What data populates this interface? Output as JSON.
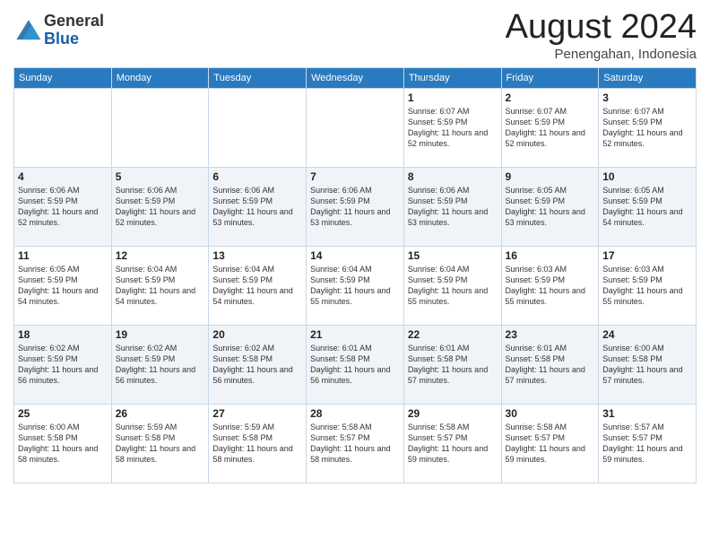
{
  "header": {
    "logo_general": "General",
    "logo_blue": "Blue",
    "month_title": "August 2024",
    "location": "Penengahan, Indonesia"
  },
  "weekdays": [
    "Sunday",
    "Monday",
    "Tuesday",
    "Wednesday",
    "Thursday",
    "Friday",
    "Saturday"
  ],
  "weeks": [
    [
      {
        "day": "",
        "sunrise": "",
        "sunset": "",
        "daylight": ""
      },
      {
        "day": "",
        "sunrise": "",
        "sunset": "",
        "daylight": ""
      },
      {
        "day": "",
        "sunrise": "",
        "sunset": "",
        "daylight": ""
      },
      {
        "day": "",
        "sunrise": "",
        "sunset": "",
        "daylight": ""
      },
      {
        "day": "1",
        "sunrise": "Sunrise: 6:07 AM",
        "sunset": "Sunset: 5:59 PM",
        "daylight": "Daylight: 11 hours and 52 minutes."
      },
      {
        "day": "2",
        "sunrise": "Sunrise: 6:07 AM",
        "sunset": "Sunset: 5:59 PM",
        "daylight": "Daylight: 11 hours and 52 minutes."
      },
      {
        "day": "3",
        "sunrise": "Sunrise: 6:07 AM",
        "sunset": "Sunset: 5:59 PM",
        "daylight": "Daylight: 11 hours and 52 minutes."
      }
    ],
    [
      {
        "day": "4",
        "sunrise": "Sunrise: 6:06 AM",
        "sunset": "Sunset: 5:59 PM",
        "daylight": "Daylight: 11 hours and 52 minutes."
      },
      {
        "day": "5",
        "sunrise": "Sunrise: 6:06 AM",
        "sunset": "Sunset: 5:59 PM",
        "daylight": "Daylight: 11 hours and 52 minutes."
      },
      {
        "day": "6",
        "sunrise": "Sunrise: 6:06 AM",
        "sunset": "Sunset: 5:59 PM",
        "daylight": "Daylight: 11 hours and 53 minutes."
      },
      {
        "day": "7",
        "sunrise": "Sunrise: 6:06 AM",
        "sunset": "Sunset: 5:59 PM",
        "daylight": "Daylight: 11 hours and 53 minutes."
      },
      {
        "day": "8",
        "sunrise": "Sunrise: 6:06 AM",
        "sunset": "Sunset: 5:59 PM",
        "daylight": "Daylight: 11 hours and 53 minutes."
      },
      {
        "day": "9",
        "sunrise": "Sunrise: 6:05 AM",
        "sunset": "Sunset: 5:59 PM",
        "daylight": "Daylight: 11 hours and 53 minutes."
      },
      {
        "day": "10",
        "sunrise": "Sunrise: 6:05 AM",
        "sunset": "Sunset: 5:59 PM",
        "daylight": "Daylight: 11 hours and 54 minutes."
      }
    ],
    [
      {
        "day": "11",
        "sunrise": "Sunrise: 6:05 AM",
        "sunset": "Sunset: 5:59 PM",
        "daylight": "Daylight: 11 hours and 54 minutes."
      },
      {
        "day": "12",
        "sunrise": "Sunrise: 6:04 AM",
        "sunset": "Sunset: 5:59 PM",
        "daylight": "Daylight: 11 hours and 54 minutes."
      },
      {
        "day": "13",
        "sunrise": "Sunrise: 6:04 AM",
        "sunset": "Sunset: 5:59 PM",
        "daylight": "Daylight: 11 hours and 54 minutes."
      },
      {
        "day": "14",
        "sunrise": "Sunrise: 6:04 AM",
        "sunset": "Sunset: 5:59 PM",
        "daylight": "Daylight: 11 hours and 55 minutes."
      },
      {
        "day": "15",
        "sunrise": "Sunrise: 6:04 AM",
        "sunset": "Sunset: 5:59 PM",
        "daylight": "Daylight: 11 hours and 55 minutes."
      },
      {
        "day": "16",
        "sunrise": "Sunrise: 6:03 AM",
        "sunset": "Sunset: 5:59 PM",
        "daylight": "Daylight: 11 hours and 55 minutes."
      },
      {
        "day": "17",
        "sunrise": "Sunrise: 6:03 AM",
        "sunset": "Sunset: 5:59 PM",
        "daylight": "Daylight: 11 hours and 55 minutes."
      }
    ],
    [
      {
        "day": "18",
        "sunrise": "Sunrise: 6:02 AM",
        "sunset": "Sunset: 5:59 PM",
        "daylight": "Daylight: 11 hours and 56 minutes."
      },
      {
        "day": "19",
        "sunrise": "Sunrise: 6:02 AM",
        "sunset": "Sunset: 5:59 PM",
        "daylight": "Daylight: 11 hours and 56 minutes."
      },
      {
        "day": "20",
        "sunrise": "Sunrise: 6:02 AM",
        "sunset": "Sunset: 5:58 PM",
        "daylight": "Daylight: 11 hours and 56 minutes."
      },
      {
        "day": "21",
        "sunrise": "Sunrise: 6:01 AM",
        "sunset": "Sunset: 5:58 PM",
        "daylight": "Daylight: 11 hours and 56 minutes."
      },
      {
        "day": "22",
        "sunrise": "Sunrise: 6:01 AM",
        "sunset": "Sunset: 5:58 PM",
        "daylight": "Daylight: 11 hours and 57 minutes."
      },
      {
        "day": "23",
        "sunrise": "Sunrise: 6:01 AM",
        "sunset": "Sunset: 5:58 PM",
        "daylight": "Daylight: 11 hours and 57 minutes."
      },
      {
        "day": "24",
        "sunrise": "Sunrise: 6:00 AM",
        "sunset": "Sunset: 5:58 PM",
        "daylight": "Daylight: 11 hours and 57 minutes."
      }
    ],
    [
      {
        "day": "25",
        "sunrise": "Sunrise: 6:00 AM",
        "sunset": "Sunset: 5:58 PM",
        "daylight": "Daylight: 11 hours and 58 minutes."
      },
      {
        "day": "26",
        "sunrise": "Sunrise: 5:59 AM",
        "sunset": "Sunset: 5:58 PM",
        "daylight": "Daylight: 11 hours and 58 minutes."
      },
      {
        "day": "27",
        "sunrise": "Sunrise: 5:59 AM",
        "sunset": "Sunset: 5:58 PM",
        "daylight": "Daylight: 11 hours and 58 minutes."
      },
      {
        "day": "28",
        "sunrise": "Sunrise: 5:58 AM",
        "sunset": "Sunset: 5:57 PM",
        "daylight": "Daylight: 11 hours and 58 minutes."
      },
      {
        "day": "29",
        "sunrise": "Sunrise: 5:58 AM",
        "sunset": "Sunset: 5:57 PM",
        "daylight": "Daylight: 11 hours and 59 minutes."
      },
      {
        "day": "30",
        "sunrise": "Sunrise: 5:58 AM",
        "sunset": "Sunset: 5:57 PM",
        "daylight": "Daylight: 11 hours and 59 minutes."
      },
      {
        "day": "31",
        "sunrise": "Sunrise: 5:57 AM",
        "sunset": "Sunset: 5:57 PM",
        "daylight": "Daylight: 11 hours and 59 minutes."
      }
    ]
  ]
}
